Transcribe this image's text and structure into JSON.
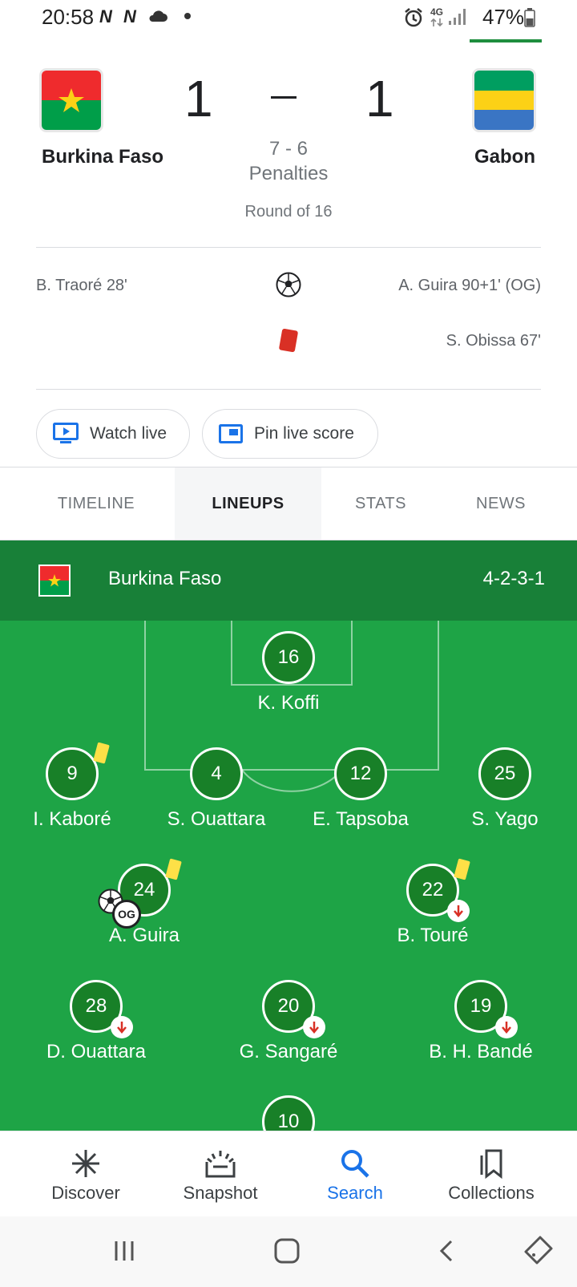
{
  "status_bar": {
    "time": "20:58",
    "network": "4G",
    "battery": "47%"
  },
  "match": {
    "home": {
      "name": "Burkina Faso",
      "score": "1"
    },
    "away": {
      "name": "Gabon",
      "score": "1"
    },
    "penalties_score": "7 - 6",
    "penalties_label": "Penalties",
    "round": "Round of 16"
  },
  "events": [
    {
      "type": "goal",
      "home": "B. Traoré 28'",
      "away": "A. Guira 90+1' (OG)"
    },
    {
      "type": "red-card",
      "home": "",
      "away": "S. Obissa 67'"
    }
  ],
  "actions": {
    "watch_live": "Watch live",
    "pin_live_score": "Pin live score"
  },
  "tabs": [
    "TIMELINE",
    "LINEUPS",
    "STATS",
    "NEWS"
  ],
  "active_tab": "LINEUPS",
  "lineup": {
    "team": "Burkina Faso",
    "formation": "4-2-3-1",
    "players": [
      {
        "number": "16",
        "name": "K. Koffi"
      },
      {
        "number": "9",
        "name": "I. Kaboré",
        "yellow_card": true
      },
      {
        "number": "4",
        "name": "S. Ouattara"
      },
      {
        "number": "12",
        "name": "E. Tapsoba"
      },
      {
        "number": "25",
        "name": "S. Yago"
      },
      {
        "number": "24",
        "name": "A. Guira",
        "yellow_card": true,
        "own_goal": true,
        "own_goal_label": "OG"
      },
      {
        "number": "22",
        "name": "B. Touré",
        "yellow_card": true,
        "subbed_off": true
      },
      {
        "number": "28",
        "name": "D. Ouattara",
        "subbed_off": true
      },
      {
        "number": "20",
        "name": "G. Sangaré",
        "subbed_off": true
      },
      {
        "number": "19",
        "name": "B. H. Bandé",
        "subbed_off": true
      },
      {
        "number": "10",
        "name": ""
      }
    ]
  },
  "bottom_nav": [
    {
      "label": "Discover",
      "icon": "asterisk-icon"
    },
    {
      "label": "Snapshot",
      "icon": "snapshot-icon"
    },
    {
      "label": "Search",
      "icon": "search-icon",
      "active": true
    },
    {
      "label": "Collections",
      "icon": "collections-icon"
    }
  ],
  "colors": {
    "pitch": "#1ea446",
    "pitch_header": "#188038",
    "accent": "#1a73e8",
    "red_card": "#d93025",
    "yellow_card": "#fde047"
  }
}
